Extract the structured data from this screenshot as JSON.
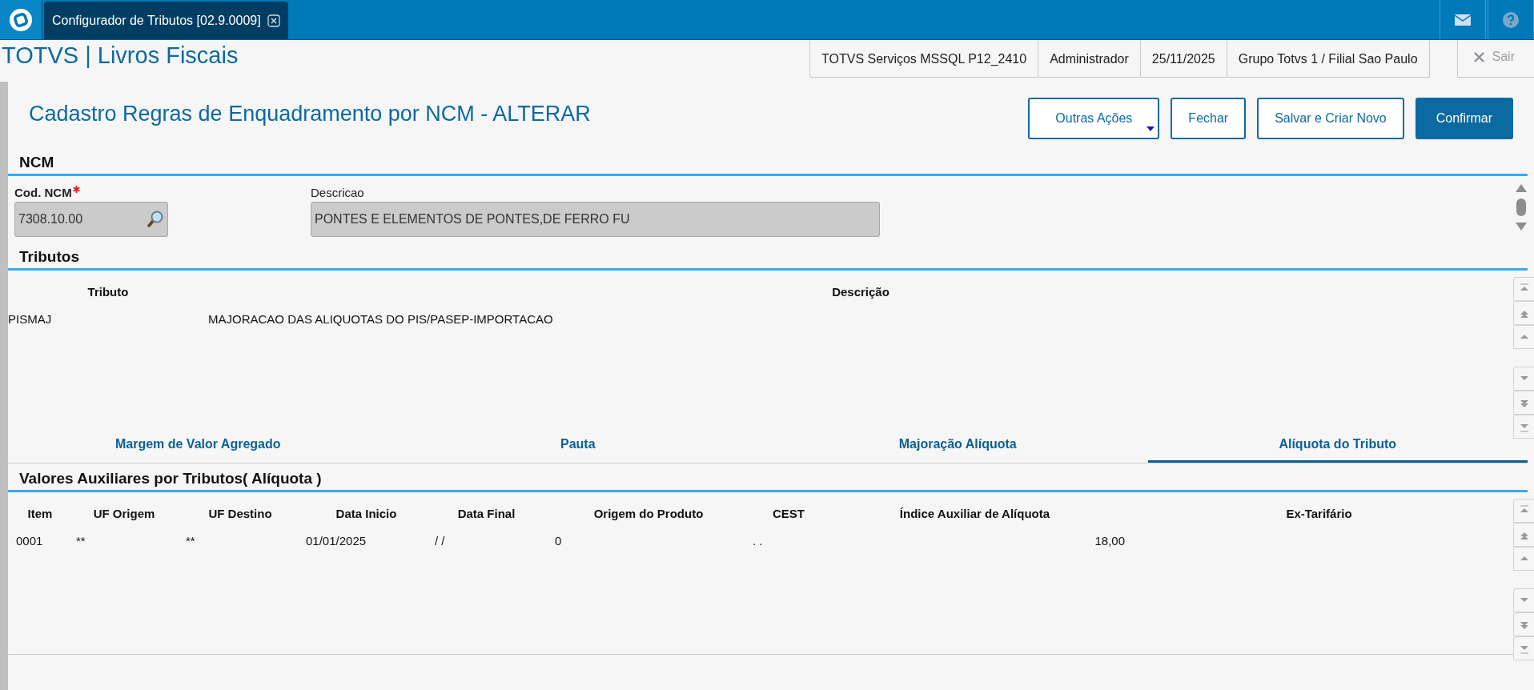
{
  "app_bar": {
    "tab_title": "Configurador de Tributos [02.9.0009]"
  },
  "header": {
    "title": "TOTVS | Livros Fiscais",
    "info": [
      "TOTVS Serviços MSSQL P12_2410",
      "Administrador",
      "25/11/2025",
      "Grupo Totvs 1 / Filial Sao Paulo"
    ],
    "exit_label": "Sair"
  },
  "form": {
    "title": "Cadastro Regras de Enquadramento por NCM - ALTERAR",
    "buttons": [
      {
        "label": "Outras Ações",
        "kind": "menu"
      },
      {
        "label": "Fechar",
        "kind": "outline"
      },
      {
        "label": "Salvar e Criar Novo",
        "kind": "outline"
      },
      {
        "label": "Confirmar",
        "kind": "primary"
      }
    ]
  },
  "ncm": {
    "heading": "NCM",
    "fields": [
      {
        "label": "Cod. NCM",
        "required": true,
        "value": "7308.10.00",
        "kind": "lookup"
      },
      {
        "label": "Descricao",
        "required": false,
        "value": "PONTES E ELEMENTOS DE PONTES,DE FERRO FU",
        "kind": "text"
      }
    ]
  },
  "tributos": {
    "heading": "Tributos",
    "columns": [
      "Tributo",
      "Descrição"
    ],
    "rows": [
      [
        "PISMAJ",
        "MAJORACAO DAS ALIQUOTAS DO PIS/PASEP-IMPORTACAO"
      ]
    ]
  },
  "tabs": [
    {
      "label": "Margem de Valor Agregado",
      "selected": false
    },
    {
      "label": "Pauta",
      "selected": false
    },
    {
      "label": "Majoração Alíquota",
      "selected": false
    },
    {
      "label": "Alíquota do Tributo",
      "selected": true
    }
  ],
  "valores": {
    "heading": "Valores Auxiliares por Tributos( Alíquota )",
    "columns": [
      "Item",
      "UF Origem",
      "UF Destino",
      "Data Inicio",
      "Data Final",
      "Origem do Produto",
      "CEST",
      "Índice Auxiliar de Alíquota",
      "Ex-Tarifário"
    ],
    "rows": [
      [
        "0001",
        "**",
        "**",
        "01/01/2025",
        "/ /",
        "0",
        ". .",
        "18,00"
      ]
    ]
  }
}
